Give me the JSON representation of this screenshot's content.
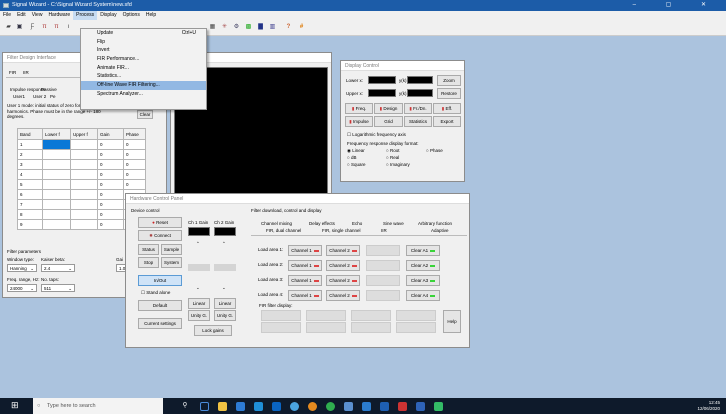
{
  "window": {
    "title": "Signal Wizard - C:\\Signal Wizard System\\new.sfd",
    "controls": "–  ▢  ✕"
  },
  "menu": [
    "File",
    "Edit",
    "View",
    "Hardware",
    "Process",
    "Display",
    "Options",
    "Help"
  ],
  "process_menu": {
    "items": [
      {
        "label": "Update",
        "shortcut": "Ctrl+U"
      },
      {
        "label": "Flip",
        "shortcut": ""
      },
      {
        "label": "Invert",
        "shortcut": ""
      },
      {
        "label": "FIR Performance...",
        "shortcut": ""
      },
      {
        "label": "Animate FIR...",
        "shortcut": ""
      },
      {
        "label": "Statistics...",
        "shortcut": ""
      },
      {
        "label": "Off-line Wave FIR Filtering...",
        "shortcut": ""
      },
      {
        "label": "Spectrum Analyzer...",
        "shortcut": ""
      }
    ],
    "highlighted_index": 6
  },
  "filter_design": {
    "title": "Filter Design Interface",
    "tabs": [
      "FIR",
      "IIR"
    ],
    "subtabs": [
      "Impulse response",
      "Passive",
      "User1",
      "User 2",
      "Pe"
    ],
    "note": "User 1 mode: initial status of zero for all harmonics. Phase must be in the range +/- 180 degrees.",
    "clear_label": "Clear",
    "columns": [
      "Band",
      "Lower f",
      "Upper f",
      "Gain",
      "Phase"
    ],
    "rows": [
      [
        "1",
        "",
        "",
        "0",
        "0"
      ],
      [
        "2",
        "",
        "",
        "0",
        "0"
      ],
      [
        "3",
        "",
        "",
        "0",
        "0"
      ],
      [
        "4",
        "",
        "",
        "0",
        "0"
      ],
      [
        "5",
        "",
        "",
        "0",
        "0"
      ],
      [
        "6",
        "",
        "",
        "0",
        "0"
      ],
      [
        "7",
        "",
        "",
        "0",
        "0"
      ],
      [
        "8",
        "",
        "",
        "0",
        "0"
      ],
      [
        "9",
        "",
        "",
        "0",
        "0"
      ]
    ],
    "params_label": "Filter parameters",
    "window_type_label": "Window type:",
    "window_type_value": "Hanning",
    "kaiser_label": "Kaiser beta:",
    "kaiser_value": "2.4",
    "gain_label": "Gai",
    "gain_value": "1.0",
    "freq_range_label": "Freq. range, Hz:",
    "freq_range_value": "24000",
    "taps_label": "No. taps:",
    "taps_value": "511"
  },
  "design_interface_2": {
    "title": "Interface"
  },
  "display_control": {
    "title": "Display Control",
    "lower_x": "Lower x:",
    "upper_x": "Upper x:",
    "y_label1": "y(k):",
    "y_label2": "y(k):",
    "zoom": "Zoom",
    "restore": "Restore",
    "row1": [
      "Freq.",
      "Design",
      "Fr./Dn.",
      "Eff."
    ],
    "row2": [
      "Impulse",
      "Grid",
      "Statistics",
      "Export"
    ],
    "log_axis": "Logarithmic frequency axis",
    "format_label": "Frequency response display format:",
    "formats": [
      "Linear",
      "Root",
      "Phase",
      "dB",
      "Real",
      "Square",
      "Imaginary"
    ]
  },
  "hardware": {
    "title": "Hardware Control Panel",
    "device_label": "Device control",
    "reset": "Reset",
    "connect": "Connect",
    "status": "Status",
    "sample": "Sample",
    "stop": "Stop",
    "system": "System",
    "inout": "In/Out",
    "standalone": "Stand alone",
    "default": "Default",
    "current": "Current settings",
    "ch1_gain": "Ch 1 Gain",
    "ch2_gain": "Ch 2 Gain",
    "linear1": "Linear",
    "linear2": "Linear",
    "unity1": "Unity G.",
    "unity2": "Unity G.",
    "lock": "Lock gains",
    "download_label": "Filter download, control and display",
    "tabs_top": [
      "Channel mixing",
      "Delay effects",
      "Echo",
      "Sine wave",
      "Arbitrary function"
    ],
    "tabs_bottom": [
      "FIR, dual channel",
      "FIR, single channel",
      "IIR",
      "Adaptive"
    ],
    "load_areas": [
      "Load area 1:",
      "Load area 2:",
      "Load area 3:",
      "Load area 4:"
    ],
    "channel1": "Channel 1",
    "channel2": "Channel 2",
    "clear_a": [
      "Clear A1",
      "Clear A2",
      "Clear A3",
      "Clear A4"
    ],
    "display_label": "FIR filter display:",
    "help": "Help"
  },
  "taskbar": {
    "search_placeholder": "Type here to search",
    "time": "12:45",
    "date": "12/06/2020"
  },
  "colors": {
    "titlebar": "#1c5ca8",
    "workspace": "#abc3de",
    "highlight": "#92b8e3",
    "selected_cell": "#0a78d7"
  }
}
